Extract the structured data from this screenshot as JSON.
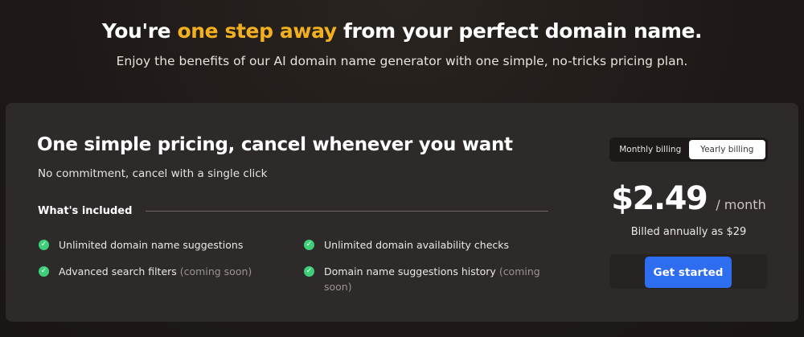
{
  "hero": {
    "title_before": "You're ",
    "title_accent": "one step away",
    "title_after": " from your perfect domain name.",
    "subtitle": "Enjoy the benefits of our AI domain name generator with one simple, no-tricks pricing plan."
  },
  "card": {
    "title": "One simple pricing, cancel whenever you want",
    "subtitle": "No commitment, cancel with a single click",
    "included_label": "What's included",
    "features": [
      {
        "text": "Unlimited domain name suggestions",
        "note": ""
      },
      {
        "text": "Advanced search filters ",
        "note": "(coming soon)"
      },
      {
        "text": "Unlimited domain availability checks",
        "note": ""
      },
      {
        "text": "Domain name suggestions history ",
        "note": "(coming soon)"
      }
    ]
  },
  "billing": {
    "options": [
      "Monthly billing",
      "Yearly billing"
    ],
    "selected": "Yearly billing",
    "price": "$2.49",
    "period": "/ month",
    "billed_note": "Billed annually as $29",
    "cta_label": "Get started"
  },
  "colors": {
    "accent": "#f2b01e",
    "check": "#3fcf7a",
    "cta": "#2f6df0",
    "card_bg": "#2d2a29",
    "page_bg": "#1f1a18"
  },
  "icons": {
    "feature_check": "check-circle-icon"
  }
}
